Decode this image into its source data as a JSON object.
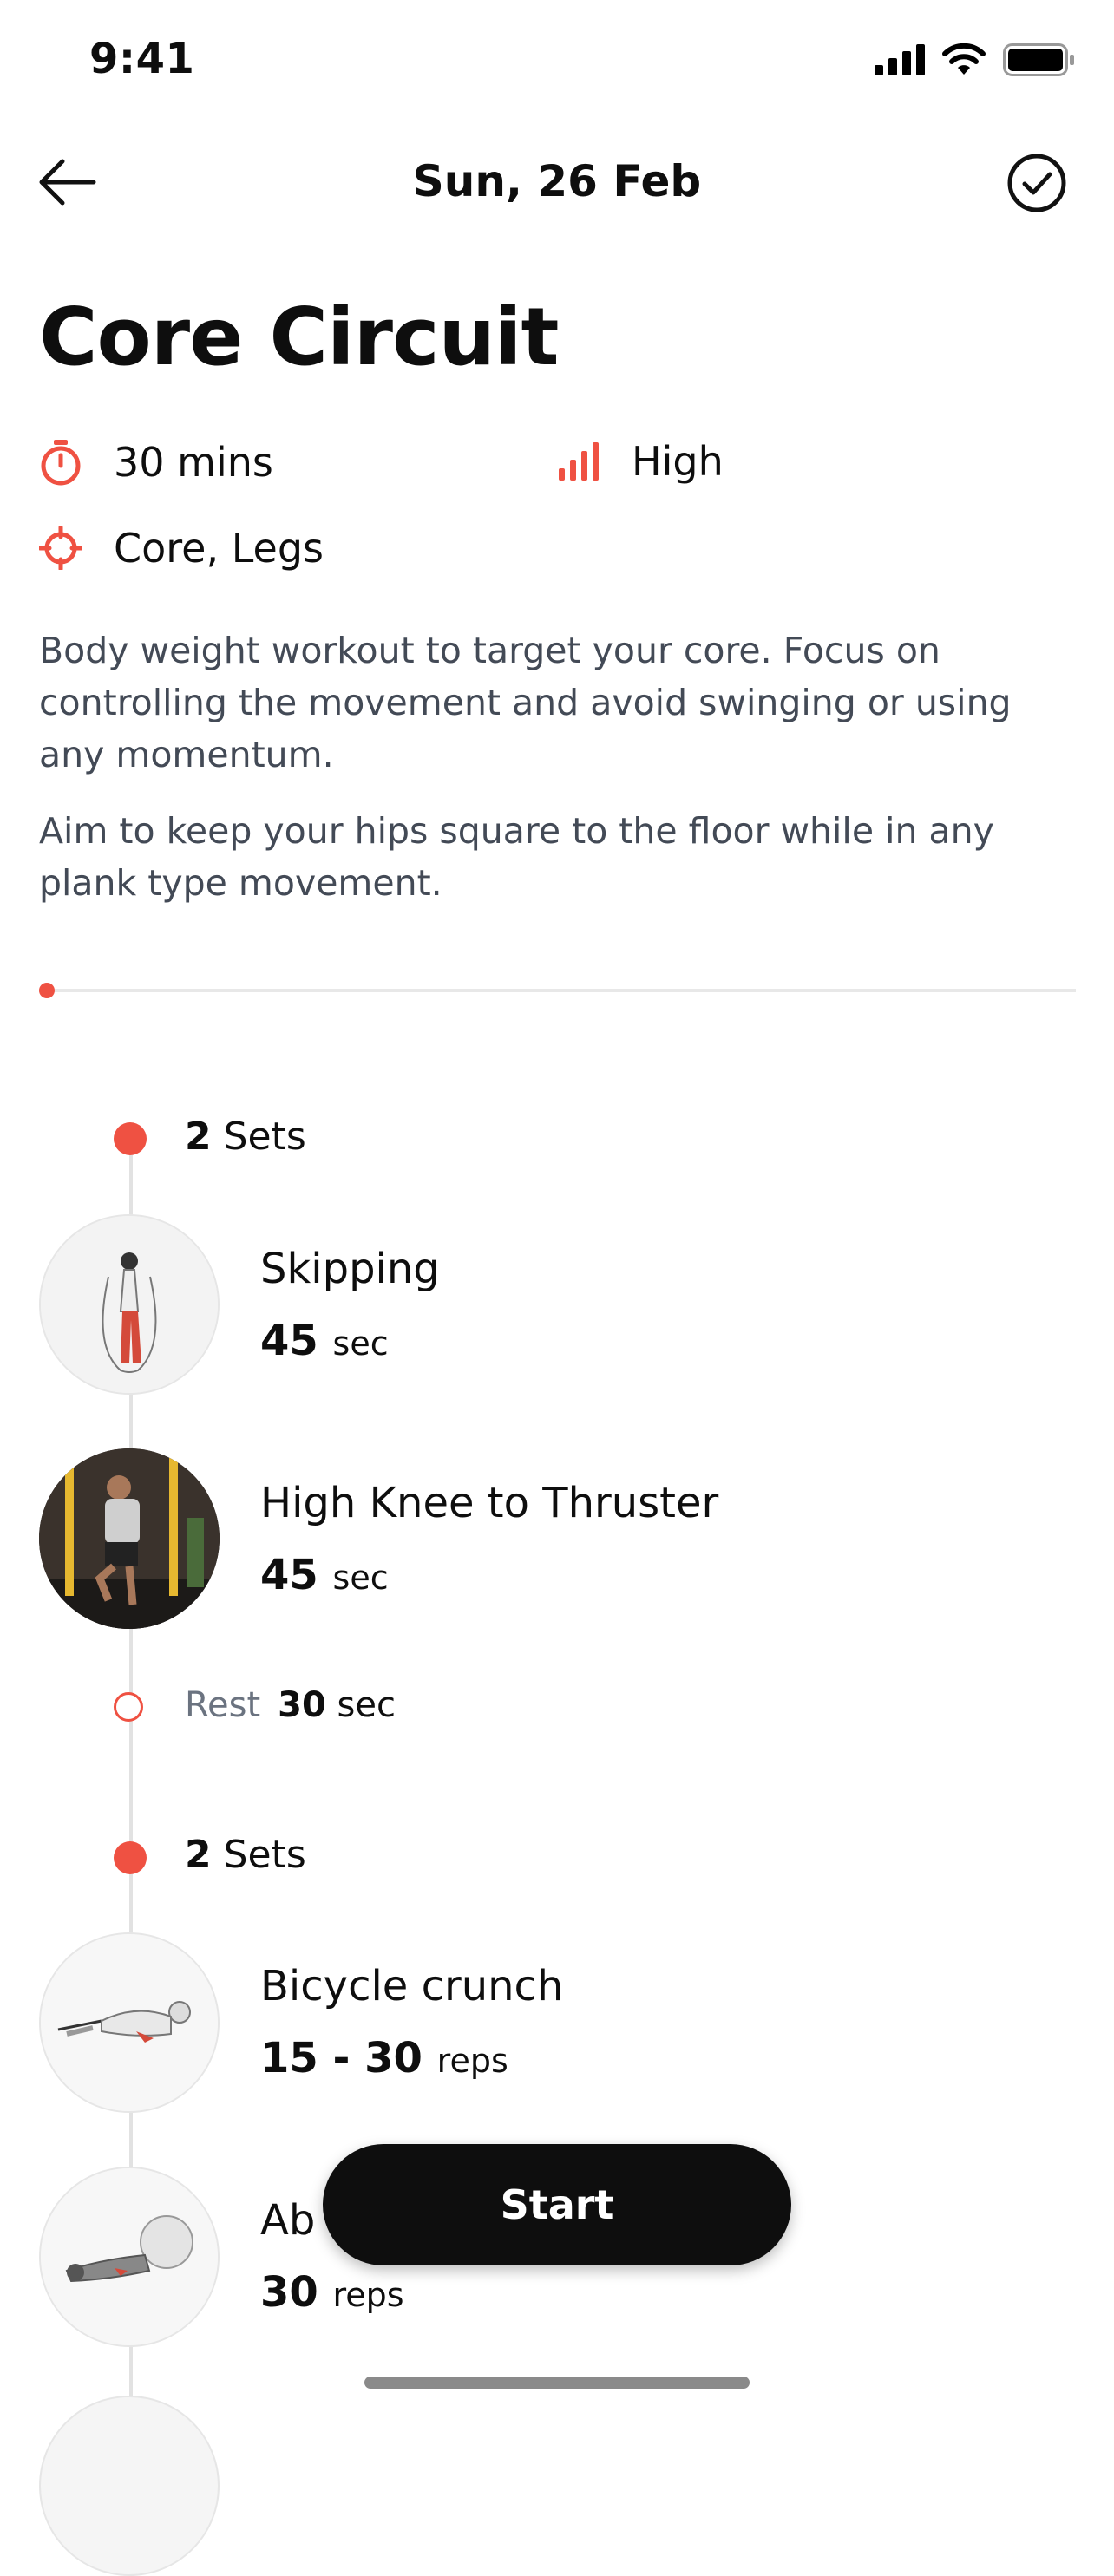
{
  "status_bar": {
    "time": "9:41"
  },
  "nav": {
    "title": "Sun, 26 Feb"
  },
  "workout": {
    "title": "Core Circuit",
    "duration": "30 mins",
    "intensity": "High",
    "target": "Core, Legs",
    "description_1": "Body weight workout to target your core. Focus on controlling the movement and avoid swinging or using any momentum.",
    "description_2": "Aim to keep your hips square to the floor while in any plank type movement."
  },
  "groups": [
    {
      "sets_count": "2",
      "sets_label": "Sets",
      "exercises": [
        {
          "name": "Skipping",
          "amount": "45",
          "unit": "sec"
        },
        {
          "name": "High Knee to Thruster",
          "amount": "45",
          "unit": "sec"
        }
      ],
      "rest": {
        "label": "Rest",
        "amount": "30",
        "unit": "sec"
      }
    },
    {
      "sets_count": "2",
      "sets_label": "Sets",
      "exercises": [
        {
          "name": "Bicycle crunch",
          "amount": "15 - 30",
          "unit": "reps"
        },
        {
          "name": "Ab",
          "amount": "30",
          "unit": "reps"
        }
      ]
    }
  ],
  "start_label": "Start",
  "accent_color": "#ef5142"
}
